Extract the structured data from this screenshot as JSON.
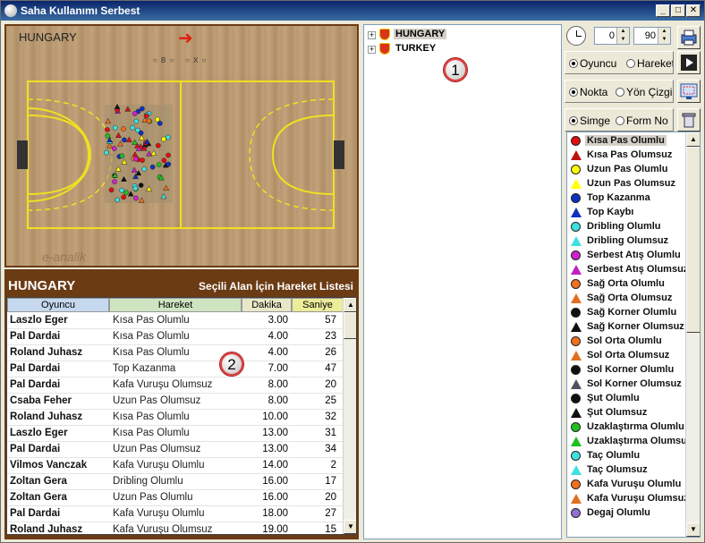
{
  "window": {
    "title": "Saha Kullanımı Serbest",
    "buttons": [
      "_",
      "□",
      "✕"
    ]
  },
  "court": {
    "team": "HUNGARY",
    "controls": [
      "○ B ○",
      "○ X ○"
    ],
    "watermark": "e-analik"
  },
  "table": {
    "team": "HUNGARY",
    "subtitle": "Seçili Alan İçin Hareket Listesi",
    "headers": [
      "Oyuncu",
      "Hareket",
      "Dakika",
      "Saniye"
    ],
    "rows": [
      [
        "Laszlo Eger",
        "Kısa Pas Olumlu",
        "3.00",
        "57"
      ],
      [
        "Pal Dardai",
        "Kısa Pas Olumlu",
        "4.00",
        "23"
      ],
      [
        "Roland Juhasz",
        "Kısa Pas Olumlu",
        "4.00",
        "26"
      ],
      [
        "Pal Dardai",
        "Top Kazanma",
        "7.00",
        "47"
      ],
      [
        "Pal Dardai",
        "Kafa Vuruşu Olumsuz",
        "8.00",
        "20"
      ],
      [
        "Csaba Feher",
        "Uzun Pas Olumsuz",
        "8.00",
        "25"
      ],
      [
        "Roland Juhasz",
        "Kısa Pas Olumlu",
        "10.00",
        "32"
      ],
      [
        "Laszlo Eger",
        "Kısa Pas Olumlu",
        "13.00",
        "31"
      ],
      [
        "Pal Dardai",
        "Uzun Pas Olumsuz",
        "13.00",
        "34"
      ],
      [
        "Vilmos Vanczak",
        "Kafa Vuruşu Olumlu",
        "14.00",
        "2"
      ],
      [
        "Zoltan Gera",
        "Dribling Olumlu",
        "16.00",
        "17"
      ],
      [
        "Zoltan Gera",
        "Uzun Pas Olumlu",
        "16.00",
        "20"
      ],
      [
        "Pal Dardai",
        "Kafa Vuruşu Olumlu",
        "18.00",
        "27"
      ],
      [
        "Roland Juhasz",
        "Kafa Vuruşu Olumsuz",
        "19.00",
        "15"
      ]
    ]
  },
  "callouts": {
    "one": "1",
    "two": "2"
  },
  "tree": {
    "items": [
      {
        "label": "HUNGARY",
        "expander": "+"
      },
      {
        "label": "TURKEY",
        "expander": "+"
      }
    ]
  },
  "controls": {
    "from_minute": "0",
    "to_minute": "90",
    "group1": [
      "Oyuncu",
      "Hareket"
    ],
    "group2": [
      "Nokta",
      "Yön Çizgi"
    ],
    "group3": [
      "Simge",
      "Form No"
    ]
  },
  "legend": {
    "items": [
      {
        "label": "Kısa Pas Olumlu",
        "shape": "circle",
        "color": "#e01010"
      },
      {
        "label": "Kısa Pas Olumsuz",
        "shape": "triangle",
        "color": "#c01010"
      },
      {
        "label": "Uzun Pas Olumlu",
        "shape": "circle",
        "color": "#ffff00"
      },
      {
        "label": "Uzun Pas Olumsuz",
        "shape": "triangle",
        "color": "#ffff00"
      },
      {
        "label": "Top Kazanma",
        "shape": "circle",
        "color": "#1030c0"
      },
      {
        "label": "Top Kaybı",
        "shape": "triangle",
        "color": "#1030c0"
      },
      {
        "label": "Dribling Olumlu",
        "shape": "circle",
        "color": "#40e0e0"
      },
      {
        "label": "Dribling Olumsuz",
        "shape": "triangle",
        "color": "#40e0e0"
      },
      {
        "label": "Serbest Atış Olumlu",
        "shape": "circle",
        "color": "#d020d0"
      },
      {
        "label": "Serbest Atış Olumsuz",
        "shape": "triangle",
        "color": "#c020c0"
      },
      {
        "label": "Sağ Orta Olumlu",
        "shape": "circle",
        "color": "#f07020"
      },
      {
        "label": "Sağ Orta Olumsuz",
        "shape": "triangle",
        "color": "#e07020"
      },
      {
        "label": "Sağ Korner Olumlu",
        "shape": "circle",
        "color": "#101010"
      },
      {
        "label": "Sağ Korner Olumsuz",
        "shape": "triangle",
        "color": "#101010"
      },
      {
        "label": "Sol Orta Olumlu",
        "shape": "circle",
        "color": "#f07020"
      },
      {
        "label": "Sol Orta Olumsuz",
        "shape": "triangle",
        "color": "#e07020"
      },
      {
        "label": "Sol Korner Olumlu",
        "shape": "circle",
        "color": "#101010"
      },
      {
        "label": "Sol Korner Olumsuz",
        "shape": "triangle",
        "color": "#505060"
      },
      {
        "label": "Şut Olumlu",
        "shape": "circle",
        "color": "#101010"
      },
      {
        "label": "Şut Olumsuz",
        "shape": "triangle",
        "color": "#101010"
      },
      {
        "label": "Uzaklaştırma Olumlu",
        "shape": "circle",
        "color": "#20c020"
      },
      {
        "label": "Uzaklaştırma Olumsuz",
        "shape": "triangle",
        "color": "#20c020"
      },
      {
        "label": "Taç Olumlu",
        "shape": "circle",
        "color": "#40e0e0"
      },
      {
        "label": "Taç Olumsuz",
        "shape": "triangle",
        "color": "#40e0e0"
      },
      {
        "label": "Kafa Vuruşu Olumlu",
        "shape": "circle",
        "color": "#f07020"
      },
      {
        "label": "Kafa Vuruşu Olumsuz",
        "shape": "triangle",
        "color": "#e07020"
      },
      {
        "label": "Degaj Olumlu",
        "shape": "circle",
        "color": "#9070d0"
      }
    ]
  }
}
